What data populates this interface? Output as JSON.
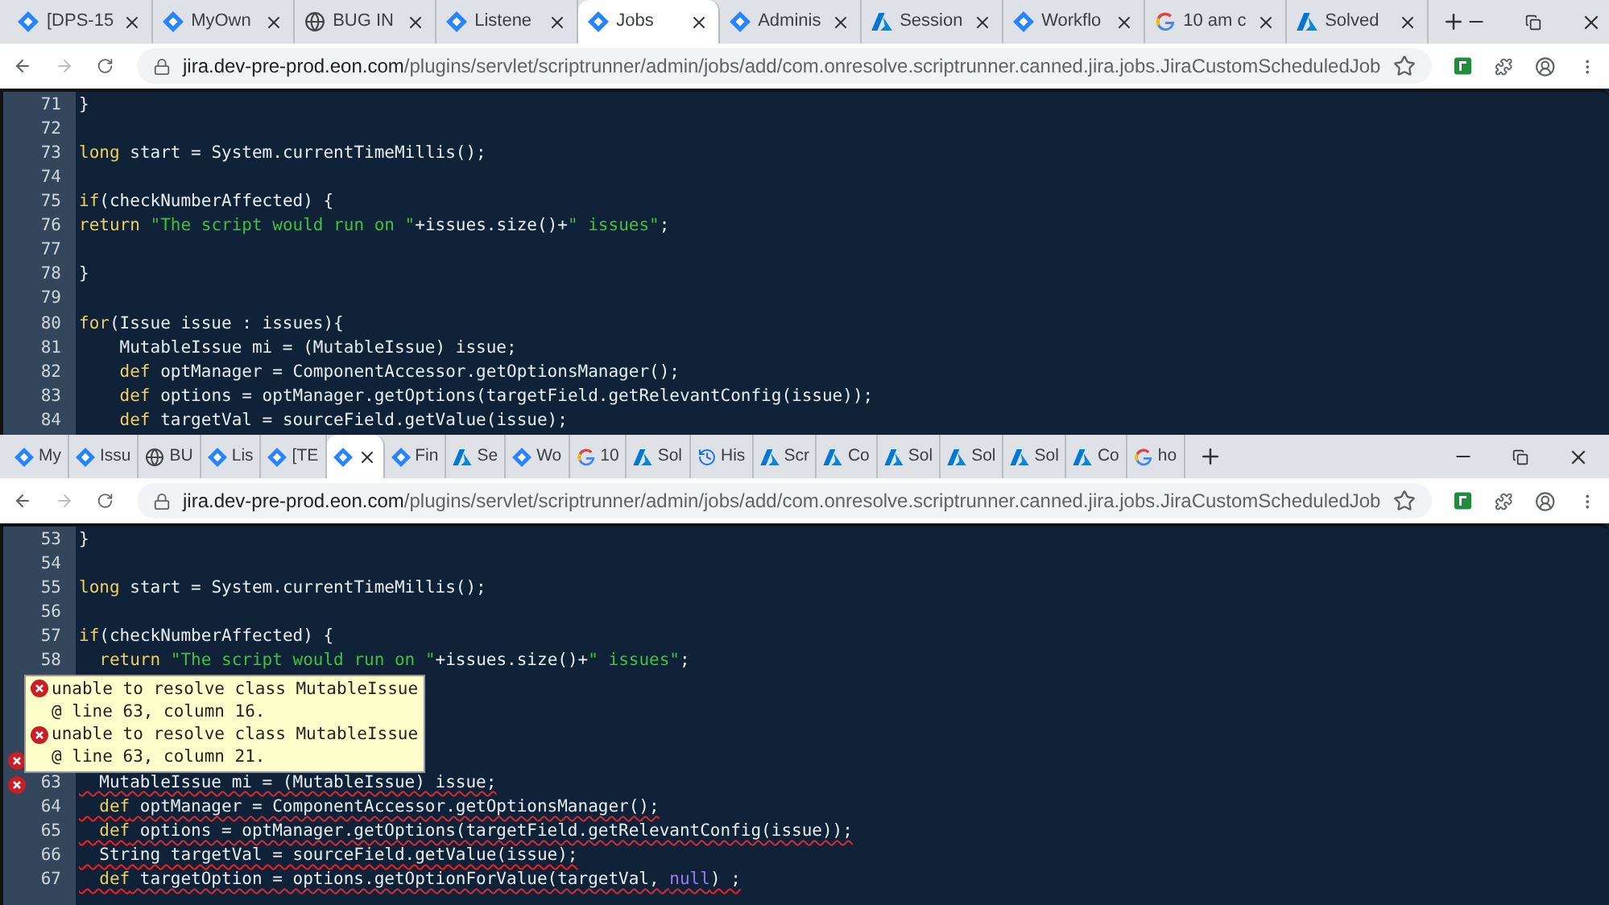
{
  "windows": [
    {
      "tabs": [
        {
          "kind": "diamond",
          "label": "[DPS-15",
          "selected": false
        },
        {
          "kind": "diamond",
          "label": "MyOwn",
          "selected": false
        },
        {
          "kind": "globe",
          "label": "BUG IN",
          "selected": false
        },
        {
          "kind": "diamond",
          "label": "Listene",
          "selected": false
        },
        {
          "kind": "diamond",
          "label": "Jobs",
          "selected": true
        },
        {
          "kind": "diamond",
          "label": "Adminis",
          "selected": false
        },
        {
          "kind": "triangle",
          "label": "Session",
          "selected": false
        },
        {
          "kind": "diamond",
          "label": "Workflo",
          "selected": false
        },
        {
          "kind": "g",
          "label": "10 am c",
          "selected": false
        },
        {
          "kind": "triangle",
          "label": "Solved",
          "selected": false
        }
      ],
      "address": {
        "host": "jira.dev-pre-prod.eon.com",
        "path": "/plugins/servlet/scriptrunner/admin/jobs/add/com.onresolve.scriptrunner.canned.jira.jobs.JiraCustomScheduledJob"
      },
      "code": [
        {
          "number": "71",
          "error": false,
          "tokens": [
            {
              "kind": "plain",
              "text": "}"
            }
          ]
        },
        {
          "number": "72",
          "error": false
        },
        {
          "number": "73",
          "error": false,
          "tokens": [
            {
              "kind": "keyword",
              "text": "long"
            },
            {
              "kind": "plain",
              "text": " start = System.currentTimeMillis();"
            }
          ]
        },
        {
          "number": "74",
          "error": false
        },
        {
          "number": "75",
          "error": false,
          "tokens": [
            {
              "kind": "keyword",
              "text": "if"
            },
            {
              "kind": "plain",
              "text": "(checkNumberAffected) {"
            }
          ]
        },
        {
          "number": "76",
          "error": false,
          "tokens": [
            {
              "kind": "keyword",
              "text": "return "
            },
            {
              "kind": "string",
              "text": "\"The script would run on \""
            },
            {
              "kind": "plain",
              "text": "+issues.size()+"
            },
            {
              "kind": "string",
              "text": "\" issues\""
            },
            {
              "kind": "plain",
              "text": ";"
            }
          ]
        },
        {
          "number": "77",
          "error": false
        },
        {
          "number": "78",
          "error": false,
          "tokens": [
            {
              "kind": "plain",
              "text": "}"
            }
          ]
        },
        {
          "number": "79",
          "error": false
        },
        {
          "number": "80",
          "error": false,
          "tokens": [
            {
              "kind": "keyword",
              "text": "for"
            },
            {
              "kind": "plain",
              "text": "(Issue issue : issues){"
            }
          ]
        },
        {
          "number": "81",
          "error": false,
          "tokens": [
            {
              "kind": "plain",
              "text": "    MutableIssue mi = (MutableIssue) issue;"
            }
          ]
        },
        {
          "number": "82",
          "error": false,
          "tokens": [
            {
              "kind": "keyword",
              "text": "    def"
            },
            {
              "kind": "plain",
              "text": " optManager = ComponentAccessor.getOptionsManager();"
            }
          ]
        },
        {
          "number": "83",
          "error": false,
          "tokens": [
            {
              "kind": "keyword",
              "text": "    def"
            },
            {
              "kind": "plain",
              "text": " options = optManager.getOptions(targetField.getRelevantConfig(issue));"
            }
          ]
        },
        {
          "number": "84",
          "error": false,
          "tokens": [
            {
              "kind": "keyword",
              "text": "    def"
            },
            {
              "kind": "plain",
              "text": " targetVal = sourceField.getValue(issue);"
            }
          ]
        }
      ]
    },
    {
      "tabs": [
        {
          "kind": "diamond",
          "label": "My",
          "selected": false
        },
        {
          "kind": "diamond",
          "label": "Issu",
          "selected": false
        },
        {
          "kind": "globe",
          "label": "BU",
          "selected": false
        },
        {
          "kind": "diamond",
          "label": "Lis",
          "selected": false
        },
        {
          "kind": "diamond",
          "label": "[TE",
          "selected": false
        },
        {
          "kind": "diamond",
          "selected": true
        },
        {
          "kind": "diamond",
          "label": "Fin",
          "selected": false
        },
        {
          "kind": "triangle",
          "label": "Se",
          "selected": false
        },
        {
          "kind": "diamond",
          "label": "Wo",
          "selected": false
        },
        {
          "kind": "g",
          "label": "10",
          "selected": false
        },
        {
          "kind": "triangle",
          "label": "Sol",
          "selected": false
        },
        {
          "kind": "history",
          "label": "His",
          "selected": false
        },
        {
          "kind": "triangle",
          "label": "Scr",
          "selected": false
        },
        {
          "kind": "triangle",
          "label": "Co",
          "selected": false
        },
        {
          "kind": "triangle",
          "label": "Sol",
          "selected": false
        },
        {
          "kind": "triangle",
          "label": "Sol",
          "selected": false
        },
        {
          "kind": "triangle",
          "label": "Sol",
          "selected": false
        },
        {
          "kind": "triangle",
          "label": "Co",
          "selected": false
        },
        {
          "kind": "g",
          "label": "ho",
          "selected": false
        }
      ],
      "address": {
        "host": "jira.dev-pre-prod.eon.com",
        "path": "/plugins/servlet/scriptrunner/admin/jobs/add/com.onresolve.scriptrunner.canned.jira.jobs.JiraCustomScheduledJob"
      },
      "code": [
        {
          "number": "53",
          "error": false,
          "tokens": [
            {
              "kind": "plain",
              "text": "}"
            }
          ]
        },
        {
          "number": "54",
          "error": false
        },
        {
          "number": "55",
          "error": false,
          "tokens": [
            {
              "kind": "keyword",
              "text": "long"
            },
            {
              "kind": "plain",
              "text": " start = System.currentTimeMillis();"
            }
          ]
        },
        {
          "number": "56",
          "error": false
        },
        {
          "number": "57",
          "error": false,
          "tokens": [
            {
              "kind": "keyword",
              "text": "if"
            },
            {
              "kind": "plain",
              "text": "(checkNumberAffected) {"
            }
          ]
        },
        {
          "number": "58",
          "error": false,
          "tokens": [
            {
              "kind": "keyword",
              "text": "  return "
            },
            {
              "kind": "string",
              "text": "\"The script would run on \""
            },
            {
              "kind": "plain",
              "text": "+issues.size()+"
            },
            {
              "kind": "string",
              "text": "\" issues\""
            },
            {
              "kind": "plain",
              "text": ";"
            }
          ]
        }
      ],
      "tooltip": [
        {
          "message": "unable to resolve class MutableIssue",
          "location": "@ line 63, column 16."
        },
        {
          "message": "unable to resolve class MutableIssue",
          "location": "@ line 63, column 21."
        }
      ],
      "code_after": [
        {
          "number": "63",
          "error": true,
          "tokens": [
            {
              "kind": "plain",
              "text": "  MutableIssue mi = (MutableIssue) issue;"
            }
          ]
        },
        {
          "number": "64",
          "error": true,
          "tokens": [
            {
              "kind": "keyword",
              "text": "  def"
            },
            {
              "kind": "plain",
              "text": " optManager = ComponentAccessor.getOptionsManager();"
            }
          ]
        },
        {
          "number": "65",
          "error": true,
          "tokens": [
            {
              "kind": "keyword",
              "text": "  def"
            },
            {
              "kind": "plain",
              "text": " options = optManager.getOptions(targetField.getRelevantConfig(issue));"
            }
          ]
        },
        {
          "number": "66",
          "error": true,
          "tokens": [
            {
              "kind": "plain",
              "text": "  String targetVal = sourceField.getValue(issue);"
            }
          ]
        },
        {
          "number": "67",
          "error": true,
          "tokens": [
            {
              "kind": "keyword",
              "text": "  def"
            },
            {
              "kind": "plain",
              "text": " targetOption = options.getOptionForValue(targetVal, "
            },
            {
              "kind": "literal",
              "text": "null"
            },
            {
              "kind": "plain",
              "text": ") ;"
            }
          ]
        }
      ]
    }
  ]
}
